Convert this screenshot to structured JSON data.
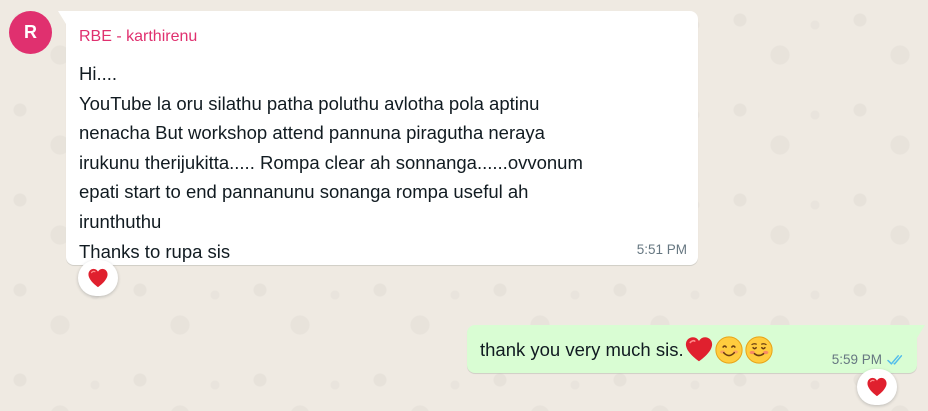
{
  "chat": {
    "incoming": {
      "avatar_initial": "R",
      "sender": "RBE - karthirenu",
      "lines": [
        "Hi....",
        "YouTube la oru silathu patha poluthu avlotha pola aptinu",
        "nenacha But workshop attend pannuna piragutha neraya",
        "irukunu therijukitta..... Rompa clear ah sonnanga......ovvonum",
        "epati start to end pannanunu sonanga rompa useful ah",
        "irunthuthu",
        "Thanks to rupa sis"
      ],
      "time": "5:51 PM",
      "reaction_icon": "red-heart-icon"
    },
    "outgoing": {
      "text": "thank you very much sis.",
      "emojis": [
        "red-heart-icon",
        "smiling-face-icon",
        "smiling-blush-face-icon"
      ],
      "time": "5:59 PM",
      "status_icon": "double-check-read-icon",
      "status_color": "#53bdeb",
      "reaction_icon": "red-heart-icon"
    }
  },
  "colors": {
    "background": "#efeae2",
    "incoming_bubble": "#ffffff",
    "outgoing_bubble": "#d9fdd3",
    "sender_name": "#e0306f",
    "avatar": "#e0306f",
    "timestamp": "#667781"
  }
}
